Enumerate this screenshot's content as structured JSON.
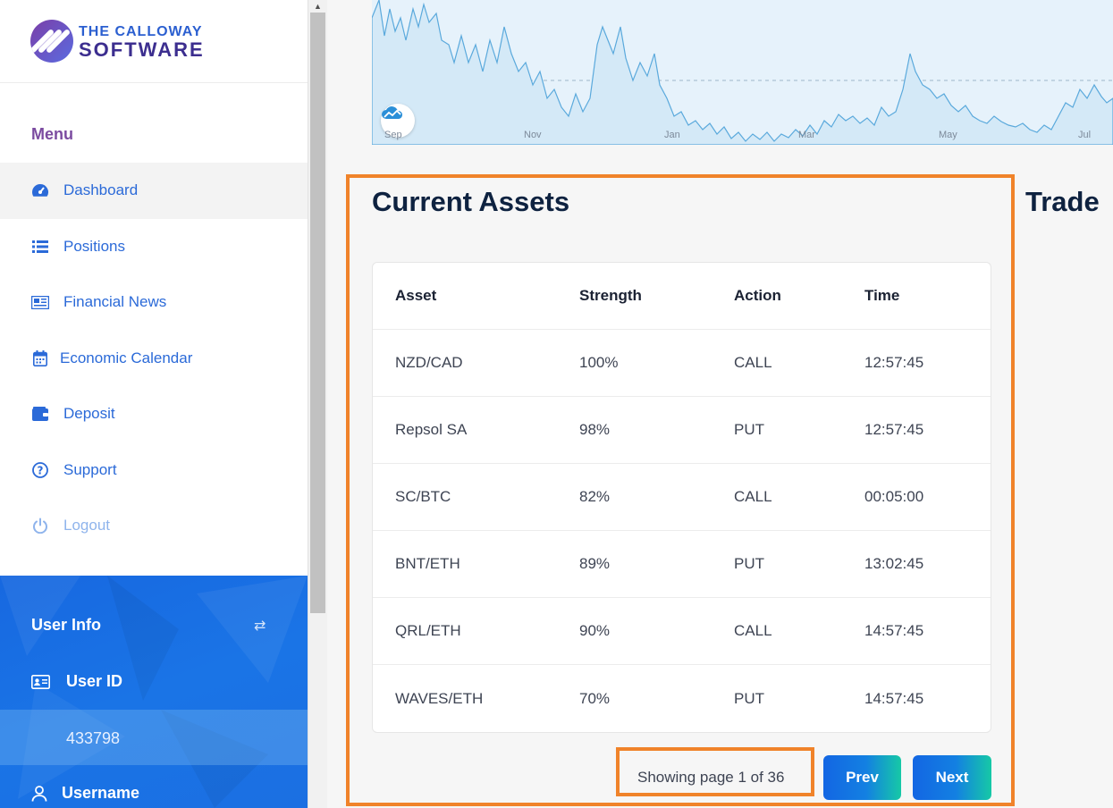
{
  "brand": {
    "line1": "THE CALLOWAY",
    "line2": "SOFTWARE"
  },
  "menu": {
    "title": "Menu",
    "items": [
      {
        "label": "Dashboard",
        "icon": "dashboard-gauge-icon",
        "active": true
      },
      {
        "label": "Positions",
        "icon": "list-icon"
      },
      {
        "label": "Financial News",
        "icon": "newspaper-icon"
      },
      {
        "label": "Economic Calendar",
        "icon": "calendar-icon"
      },
      {
        "label": "Deposit",
        "icon": "wallet-icon"
      },
      {
        "label": "Support",
        "icon": "question-circle-icon"
      },
      {
        "label": "Logout",
        "icon": "power-icon"
      }
    ]
  },
  "user_info": {
    "title": "User Info",
    "user_id_label": "User ID",
    "user_id_value": "433798",
    "username_label": "Username"
  },
  "chart": {
    "x_ticks": [
      "Sep",
      "Nov",
      "Jan",
      "Mar",
      "May",
      "Jul"
    ],
    "fill_color": "#d4e9f7",
    "line_color": "#5aa9dc"
  },
  "assets": {
    "title": "Current Assets",
    "columns": [
      "Asset",
      "Strength",
      "Action",
      "Time"
    ],
    "rows": [
      [
        "NZD/CAD",
        "100%",
        "CALL",
        "12:57:45"
      ],
      [
        "Repsol SA",
        "98%",
        "PUT",
        "12:57:45"
      ],
      [
        "SC/BTC",
        "82%",
        "CALL",
        "00:05:00"
      ],
      [
        "BNT/ETH",
        "89%",
        "PUT",
        "13:02:45"
      ],
      [
        "QRL/ETH",
        "90%",
        "CALL",
        "14:57:45"
      ],
      [
        "WAVES/ETH",
        "70%",
        "PUT",
        "14:57:45"
      ]
    ]
  },
  "pagination": {
    "info": "Showing page 1 of 36",
    "prev": "Prev",
    "next": "Next"
  },
  "trade": {
    "title": "Trade"
  },
  "colors": {
    "accent": "#1366e3",
    "highlight": "#f0832a",
    "menu_title": "#7b4ba0"
  }
}
